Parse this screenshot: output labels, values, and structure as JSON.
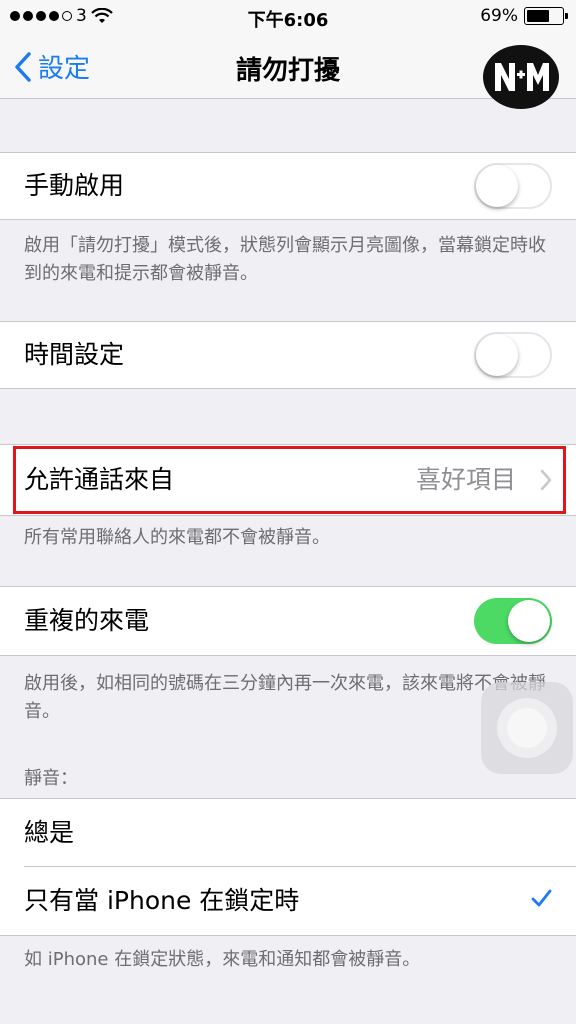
{
  "status_bar": {
    "carrier": "3",
    "time": "下午6:06",
    "battery_percent": "69%",
    "battery_level": 0.69
  },
  "nav": {
    "back_label": "設定",
    "title": "請勿打擾"
  },
  "manual": {
    "label": "手動啟用",
    "toggle_on": false,
    "footer": "啟用「請勿打擾」模式後，狀態列會顯示月亮圖像，當幕鎖定時收到的來電和提示都會被靜音。"
  },
  "scheduled": {
    "label": "時間設定",
    "toggle_on": false
  },
  "allow_calls": {
    "label": "允許通話來自",
    "value": "喜好項目",
    "footer": "所有常用聯絡人的來電都不會被靜音。"
  },
  "repeated": {
    "label": "重複的來電",
    "toggle_on": true,
    "footer": "啟用後，如相同的號碼在三分鐘內再一次來電，該來電將不會被靜音。"
  },
  "silence": {
    "header": "靜音：",
    "options": [
      {
        "label": "總是",
        "checked": false
      },
      {
        "label": "只有當 iPhone 在鎖定時",
        "checked": true
      }
    ],
    "footer": "如 iPhone 在鎖定狀態，來電和通知都會被靜音。"
  },
  "colors": {
    "accent": "#1b7cf2",
    "switch_on": "#4cd964",
    "highlight": "#e0161d",
    "background": "#efeff4"
  }
}
